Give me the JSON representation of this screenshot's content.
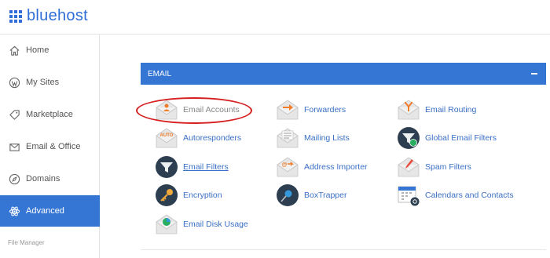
{
  "brand": {
    "name": "bluehost"
  },
  "sidebar": {
    "items": [
      {
        "label": "Home",
        "icon": "home-icon"
      },
      {
        "label": "My Sites",
        "icon": "wordpress-icon"
      },
      {
        "label": "Marketplace",
        "icon": "tag-icon"
      },
      {
        "label": "Email & Office",
        "icon": "envelope-icon"
      },
      {
        "label": "Domains",
        "icon": "compass-icon"
      },
      {
        "label": "Advanced",
        "icon": "atom-icon",
        "active": true
      }
    ],
    "footer_label": "File Manager"
  },
  "panel": {
    "title": "EMAIL",
    "collapse_icon": "minus-icon",
    "tools": [
      {
        "label": "Email Accounts",
        "icon": "email-accounts-icon",
        "highlighted": true
      },
      {
        "label": "Forwarders",
        "icon": "forwarders-icon"
      },
      {
        "label": "Email Routing",
        "icon": "email-routing-icon"
      },
      {
        "label": "Autoresponders",
        "icon": "autoresponders-icon"
      },
      {
        "label": "Mailing Lists",
        "icon": "mailing-lists-icon"
      },
      {
        "label": "Global Email Filters",
        "icon": "global-email-filters-icon"
      },
      {
        "label": "Email Filters",
        "icon": "email-filters-icon",
        "underlined": true
      },
      {
        "label": "Address Importer",
        "icon": "address-importer-icon"
      },
      {
        "label": "Spam Filters",
        "icon": "spam-filters-icon"
      },
      {
        "label": "Encryption",
        "icon": "encryption-icon"
      },
      {
        "label": "BoxTrapper",
        "icon": "boxtrapper-icon"
      },
      {
        "label": "Calendars and Contacts",
        "icon": "calendars-contacts-icon"
      },
      {
        "label": "Email Disk Usage",
        "icon": "email-disk-usage-icon"
      }
    ],
    "auto_badge": "AUTO",
    "address_badge": "@"
  },
  "colors": {
    "accent": "#3575d3",
    "link": "#3a6fc4",
    "highlight": "#d62020",
    "orange": "#f07d2a"
  }
}
